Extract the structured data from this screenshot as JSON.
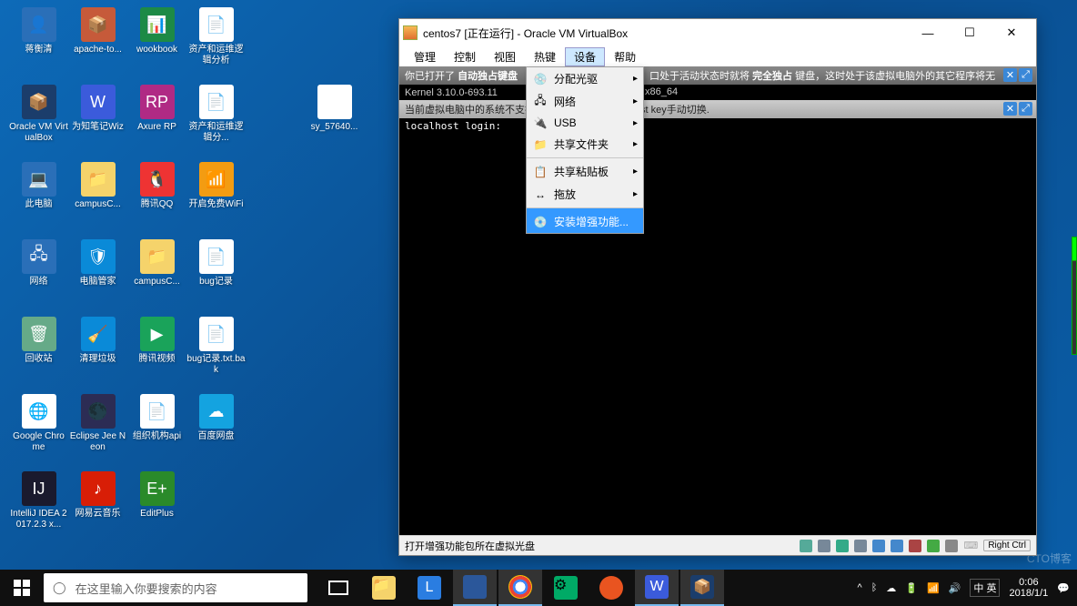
{
  "desktop_icons": [
    {
      "label": "蒋衡清",
      "color": "#2a6fb8",
      "glyph": "👤"
    },
    {
      "label": "apache-to...",
      "color": "#c65a3a",
      "glyph": "📦"
    },
    {
      "label": "wookbook",
      "color": "#1d8a46",
      "glyph": "📊"
    },
    {
      "label": "资产和运维逻辑分析",
      "color": "#fff",
      "glyph": "📄"
    },
    {
      "label": "",
      "color": "transparent",
      "glyph": ""
    },
    {
      "label": "",
      "color": "transparent",
      "glyph": ""
    },
    {
      "label": "Oracle VM VirtualBox",
      "color": "#1b3d6b",
      "glyph": "📦"
    },
    {
      "label": "为知笔记Wiz",
      "color": "#3b5bdb",
      "glyph": "W"
    },
    {
      "label": "Axure RP",
      "color": "#b02a84",
      "glyph": "RP"
    },
    {
      "label": "资产和运维逻辑分...",
      "color": "#fff",
      "glyph": "📄"
    },
    {
      "label": "",
      "color": "transparent",
      "glyph": ""
    },
    {
      "label": "sy_57640...",
      "color": "#fff",
      "glyph": "🖼"
    },
    {
      "label": "此电脑",
      "color": "#2a6fb8",
      "glyph": "💻"
    },
    {
      "label": "campusC...",
      "color": "#f5d36b",
      "glyph": "📁"
    },
    {
      "label": "腾讯QQ",
      "color": "#e33",
      "glyph": "🐧"
    },
    {
      "label": "开启免费WiFi",
      "color": "#f39c12",
      "glyph": "📶"
    },
    {
      "label": "",
      "color": "transparent",
      "glyph": ""
    },
    {
      "label": "",
      "color": "transparent",
      "glyph": ""
    },
    {
      "label": "网络",
      "color": "#2a6fb8",
      "glyph": "🖧"
    },
    {
      "label": "电脑管家",
      "color": "#0a8ad8",
      "glyph": "🛡"
    },
    {
      "label": "campusC...",
      "color": "#f5d36b",
      "glyph": "📁"
    },
    {
      "label": "bug记录",
      "color": "#fff",
      "glyph": "📄"
    },
    {
      "label": "",
      "color": "transparent",
      "glyph": ""
    },
    {
      "label": "",
      "color": "transparent",
      "glyph": ""
    },
    {
      "label": "回收站",
      "color": "#6a8",
      "glyph": "🗑"
    },
    {
      "label": "清理垃圾",
      "color": "#0a8ad8",
      "glyph": "🧹"
    },
    {
      "label": "腾讯视频",
      "color": "#1aa35a",
      "glyph": "▶"
    },
    {
      "label": "bug记录.txt.bak",
      "color": "#fff",
      "glyph": "📄"
    },
    {
      "label": "",
      "color": "transparent",
      "glyph": ""
    },
    {
      "label": "",
      "color": "transparent",
      "glyph": ""
    },
    {
      "label": "Google Chrome",
      "color": "#fff",
      "glyph": "🌐"
    },
    {
      "label": "Eclipse Jee Neon",
      "color": "#2c2c54",
      "glyph": "🌑"
    },
    {
      "label": "组织机构api",
      "color": "#fff",
      "glyph": "📄"
    },
    {
      "label": "百度网盘",
      "color": "#14a3e0",
      "glyph": "☁"
    },
    {
      "label": "",
      "color": "transparent",
      "glyph": ""
    },
    {
      "label": "",
      "color": "transparent",
      "glyph": ""
    },
    {
      "label": "IntelliJ IDEA 2017.2.3 x...",
      "color": "#1a1a2e",
      "glyph": "IJ"
    },
    {
      "label": "网易云音乐",
      "color": "#d81e06",
      "glyph": "♪"
    },
    {
      "label": "EditPlus",
      "color": "#2a8a2a",
      "glyph": "E+"
    }
  ],
  "vbox": {
    "title": "centos7 [正在运行] - Oracle VM VirtualBox",
    "menu": [
      "管理",
      "控制",
      "视图",
      "热键",
      "设备",
      "帮助"
    ],
    "active_menu": "设备",
    "dropdown": [
      {
        "label": "分配光驱",
        "icon": "💿",
        "sub": true
      },
      {
        "label": "网络",
        "icon": "🖧",
        "sub": true
      },
      {
        "label": "USB",
        "icon": "🔌",
        "sub": true
      },
      {
        "label": "共享文件夹",
        "icon": "📁",
        "sub": true
      },
      {
        "label": "共享粘贴板",
        "icon": "📋",
        "sub": true,
        "sep": true
      },
      {
        "label": "拖放",
        "icon": "↔",
        "sub": true
      },
      {
        "label": "安装增强功能...",
        "icon": "💿",
        "sub": false,
        "sep": true,
        "hl": true
      }
    ],
    "notify1_a": "你已打开了 ",
    "notify1_b": "自动独占键盘",
    "notify1_c": "口处于活动状态时就将 ",
    "notify1_d": "完全独占 ",
    "notify1_e": "键盘，这时处于该虚拟电脑外的其它程序将无",
    "kernel": "Kernel 3.10.0-693.11",
    "arch": "x86_64",
    "notify2_a": "当前虚拟电脑中的系统不支持",
    "notify2_b": "st key手动切换.",
    "login": "localhost login:",
    "status_left": "打开增强功能包所在虚拟光盘",
    "host_key": "Right Ctrl"
  },
  "taskbar": {
    "search_placeholder": "在这里输入你要搜索的内容",
    "ime": "中 英",
    "time": "0:06",
    "date": "2018/1/1"
  },
  "watermark": "CTO博客"
}
